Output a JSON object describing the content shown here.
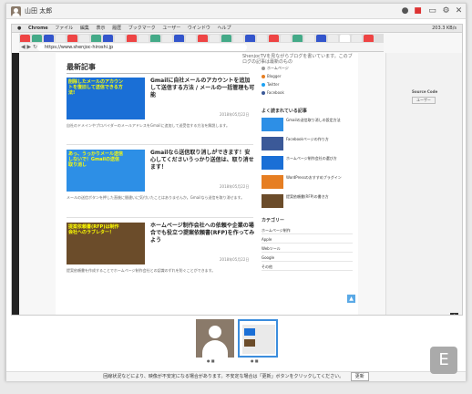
{
  "app": {
    "user_name": "山田 太郎"
  },
  "browser": {
    "app_name": "Chrome",
    "menu": [
      "ファイル",
      "編集",
      "表示",
      "履歴",
      "ブックマーク",
      "ユーザー",
      "ウインドウ",
      "ヘルプ"
    ],
    "status_right": "203.3 KB/s",
    "url": "https://www.shenjoc-hiroshi.jp"
  },
  "page": {
    "ad_text": "ShenjocTVを見ながらブログを書いています。このブログの記事は最新のもの",
    "section_title": "最新記事",
    "articles": [
      {
        "thumb_text": "削除したメールのアカウントを復旧して送信できる方法!",
        "title": "Gmailに自社メールのアカウントを追加して送信する方法 / メールの一括管理も可能",
        "date": "2018年05月22日",
        "body": "自社のドメインやプロバイダーのメールアドレスをGmailに追加して送受信する方法を解説します。"
      },
      {
        "thumb_text": "あっ、うっかりメール送信しないで！Gmailの送信取り消し",
        "title": "Gmailなら送信取り消しができます！安心してくださいうっかり送信は、取り消せます！",
        "date": "2018年05月22日",
        "body": "メールの送信ボタンを押した直後に間違いに気付いたことはありませんか。Gmailなら送信を取り消せます。"
      },
      {
        "thumb_text": "提案依頼書(RFP)は制作会社へのラブレター！",
        "title": "ホームページ制作会社への依頼や企業の場合でも役立つ提案依頼書(RFP)を作ってみよう",
        "date": "2018年05月22日",
        "body": "提案依頼書を作成することでホームページ制作会社との認識のずれを防ぐことができます。"
      }
    ],
    "sidebar": {
      "follow_links": [
        "ホームページ",
        "Blogger",
        "Twitter",
        "Facebook"
      ],
      "popular_title": "よく読まれている記事",
      "popular": [
        "Gmailの送信取り消しの設定方法",
        "Facebookページの作り方",
        "ホームページ制作会社の選び方",
        "WordPressのおすすめプラグイン",
        "提案依頼書(RFP)の書き方"
      ],
      "category_title": "カテゴリー",
      "categories": [
        "ホームページ制作",
        "Apple",
        "Webツール",
        "Google",
        "その他"
      ]
    }
  },
  "right_panel": {
    "title": "Source Code",
    "button": "ユーザー"
  },
  "bottom": {
    "notice": "回線状況などにより、映像が不安定になる場合があります。不安定な場合は「更新」ボタンをクリックしてください。",
    "refresh_label": "更新"
  },
  "badge": "E"
}
